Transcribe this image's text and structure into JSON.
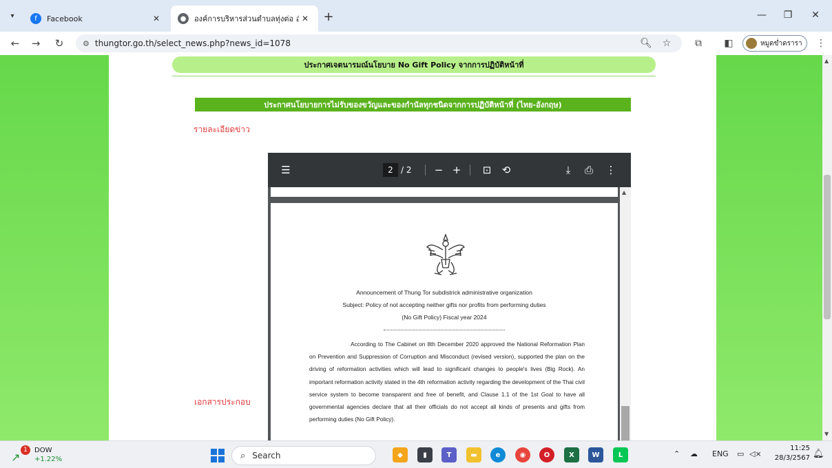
{
  "browser": {
    "tabs": [
      {
        "title": "Facebook",
        "icon": "facebook-icon",
        "active": false
      },
      {
        "title": "องค์การบริหารส่วนตำบลทุ่งต่อ อำเภอ",
        "icon": "globe-icon",
        "active": true
      }
    ],
    "url": "thungtor.go.th/select_news.php?news_id=1078",
    "profile_name": "หมูดข่ำดรารา",
    "colors": {
      "tabstrip": "#dfe8f5",
      "accent": "#1a73d9"
    }
  },
  "page": {
    "top_banner": "ประกาศเจตนารมณ์นโยบาย No Gift Policy จากการปฏิบัติหน้าที่",
    "news_title": "ประกาศนโยบายการไม่รับของขวัญและของกำนัลทุกชนิดจากการปฏิบัติหน้าที่ (ไทย-อังกฤษ)",
    "detail_label": "รายละเอียดข่าว",
    "attachment_label": "เอกสารประกอบ",
    "colors": {
      "side_green": "#7fe35e",
      "title_bar": "#5ab21d",
      "red_label": "#e23b3b"
    }
  },
  "pdf": {
    "current_page": "2",
    "total_pages": "/ 2",
    "doc_lines": [
      "Announcement  of Thung Tor subdistrick administrative organization",
      "Subject: Policy of not accepting neither gifts nor profits from performing duties",
      "(No Gift Policy) Fiscal year 2024"
    ],
    "body": "According to The Cabinet on 8th December 2020 approved the National Reformation Plan on Prevention and Suppression of Corruption and Misconduct (revised version), supported the plan on the driving of reformation activities which will lead to significant changes to people's lives (Big Rock). An important reformation activity stated in the 4th reformation activity regarding the development of the Thai civil service system to become transparent and free of benefit, and Clause 1.1 of the 1st Goal to have all governmental agencies declare that all their officials do not accept all kinds of presents and gifts from performing duties (No Gift Policy)."
  },
  "taskbar": {
    "stock_name": "DOW",
    "stock_change": "+1.22%",
    "stock_badge": "1",
    "search_placeholder": "Search",
    "lang": "ENG",
    "time": "11:25",
    "date": "28/3/2567"
  }
}
